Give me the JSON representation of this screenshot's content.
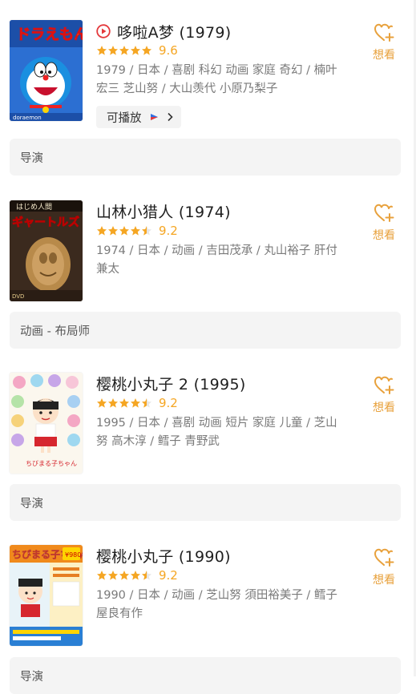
{
  "works": [
    {
      "title": "哆啦A梦 (1979)",
      "has_play_icon": true,
      "rating": "9.6",
      "stars_filled": 5,
      "meta": "1979 / 日本 / 喜剧 科幻 动画 家庭 奇幻 / 楠叶宏三 芝山努 / 大山羡代 小原乃梨子",
      "play_label": "可播放",
      "wish_label": "想看",
      "role": "导演"
    },
    {
      "title": "山林小猎人 (1974)",
      "has_play_icon": false,
      "rating": "9.2",
      "stars_filled": 4.5,
      "meta": "1974 / 日本 / 动画 / 吉田茂承 / 丸山裕子 肝付兼太",
      "wish_label": "想看",
      "role": "动画 - 布局师"
    },
    {
      "title": "樱桃小丸子 2 (1995)",
      "has_play_icon": false,
      "rating": "9.2",
      "stars_filled": 4.5,
      "meta": "1995 / 日本 / 喜剧 动画 短片 家庭 儿童 / 芝山努 高木淳 / 鳕子 青野武",
      "wish_label": "想看",
      "role": "导演"
    },
    {
      "title": "樱桃小丸子 (1990)",
      "has_play_icon": false,
      "rating": "9.2",
      "stars_filled": 4.5,
      "meta": "1990 / 日本 / 动画 / 芝山努 須田裕美子 / 鳕子 屋良有作",
      "wish_label": "想看",
      "role": "导演"
    }
  ],
  "colors": {
    "accent": "#e8a13c",
    "star": "#f5a623",
    "play_red": "#e4393c",
    "muted_text": "#7a7a7a",
    "role_bg": "#f4f4f4"
  },
  "icons": {
    "play": "play-circle-icon",
    "wish": "heart-plus-icon",
    "streaming": "streaming-logo-icon",
    "chevron": "chevron-right-icon",
    "star": "star-icon"
  }
}
